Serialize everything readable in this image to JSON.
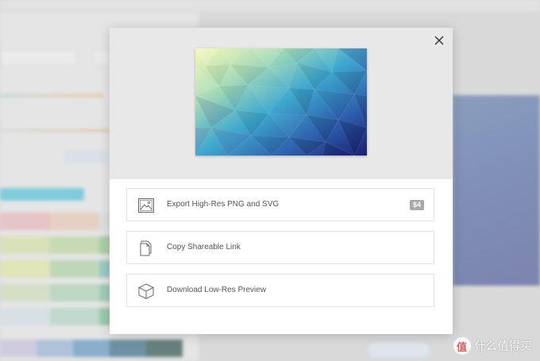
{
  "background_app": {
    "tabs": [
      "",
      "",
      ""
    ]
  },
  "modal": {
    "close_icon": "close-x-icon",
    "preview_image": "low-poly-gradient-yellow-teal-navy",
    "options": [
      {
        "label": "Export High-Res PNG and SVG",
        "icon": "image-icon",
        "badge": "$4"
      },
      {
        "label": "Copy Shareable Link",
        "icon": "copy-pages-icon"
      },
      {
        "label": "Download Low-Res Preview",
        "icon": "cube-icon"
      }
    ]
  },
  "watermark": {
    "text": "什么值得买",
    "seal": "值"
  },
  "colors": {
    "modal_top": "#e8e8e8",
    "badge": "#a9a9a9",
    "option_border": "#e2e2e2"
  }
}
